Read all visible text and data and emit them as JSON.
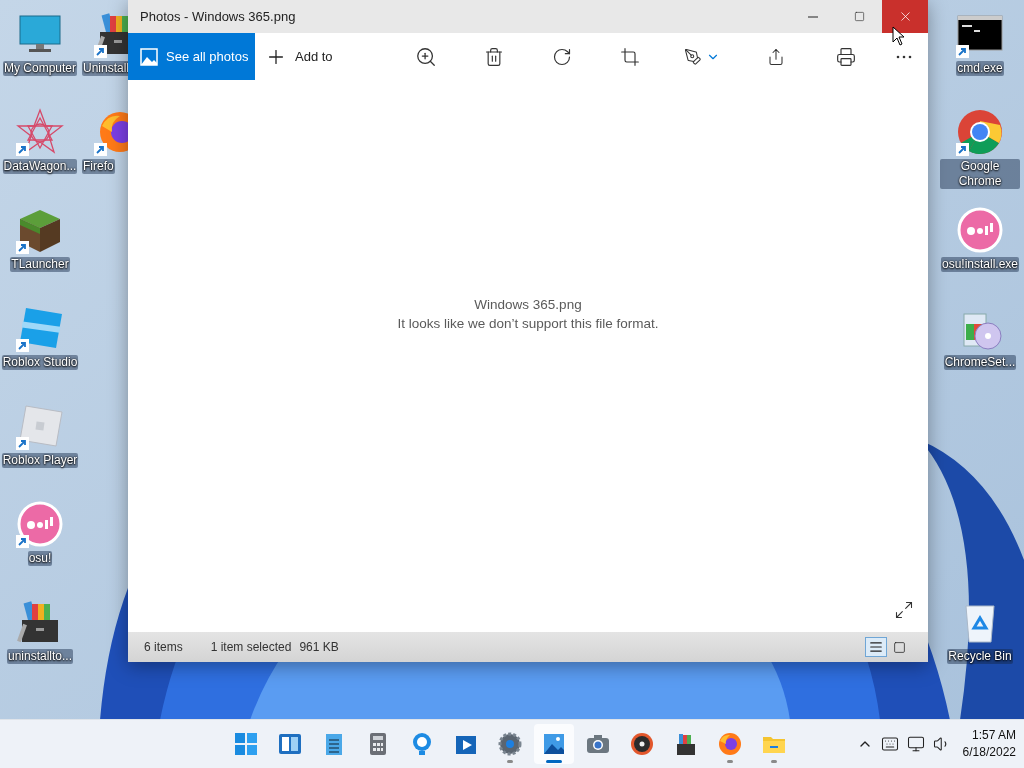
{
  "desktop": {
    "left_icons": [
      {
        "label": "My Computer",
        "shortcut": false
      },
      {
        "label": "DataWagon...",
        "shortcut": true
      },
      {
        "label": "TLauncher",
        "shortcut": true
      },
      {
        "label": "Roblox Studio",
        "shortcut": true
      },
      {
        "label": "Roblox Player",
        "shortcut": true
      },
      {
        "label": "osu!",
        "shortcut": true
      },
      {
        "label": "uninstallto...",
        "shortcut": false
      }
    ],
    "second_column_icons": [
      {
        "label": "Uninstall",
        "shortcut": true
      },
      {
        "label": "Firefo",
        "shortcut": true
      }
    ],
    "right_icons": [
      {
        "label": "cmd.exe",
        "shortcut": true
      },
      {
        "label": "Google Chrome",
        "shortcut": true
      },
      {
        "label": "osu!install.exe",
        "shortcut": false
      },
      {
        "label": "ChromeSet...",
        "shortcut": false
      },
      {
        "label": "Recycle Bin",
        "shortcut": false
      }
    ]
  },
  "window": {
    "title": "Photos - Windows 365.png",
    "toolbar": {
      "see_all": "See all photos",
      "add_to": "Add to"
    },
    "message": {
      "file_name": "Windows 365.png",
      "error": "It looks like we don’t support this file format."
    },
    "status_bar": {
      "count": "6 items",
      "selection": "1 item selected",
      "size": "961 KB",
      "views": [
        {
          "kind": "details",
          "selected": true
        },
        {
          "kind": "large",
          "selected": false
        }
      ]
    }
  },
  "taskbar": {
    "apps": [
      {
        "running": false,
        "selected": false
      },
      {
        "running": false,
        "selected": false
      },
      {
        "running": false,
        "selected": false
      },
      {
        "running": false,
        "selected": false
      },
      {
        "running": false,
        "selected": false
      },
      {
        "running": false,
        "selected": false
      },
      {
        "running": true,
        "selected": false
      },
      {
        "running": true,
        "selected": true
      },
      {
        "running": false,
        "selected": false
      },
      {
        "running": false,
        "selected": false
      },
      {
        "running": false,
        "selected": false
      },
      {
        "running": true,
        "selected": false
      },
      {
        "running": true,
        "selected": false
      }
    ],
    "clock": {
      "time": "1:57 AM",
      "date": "6/18/2022"
    }
  }
}
